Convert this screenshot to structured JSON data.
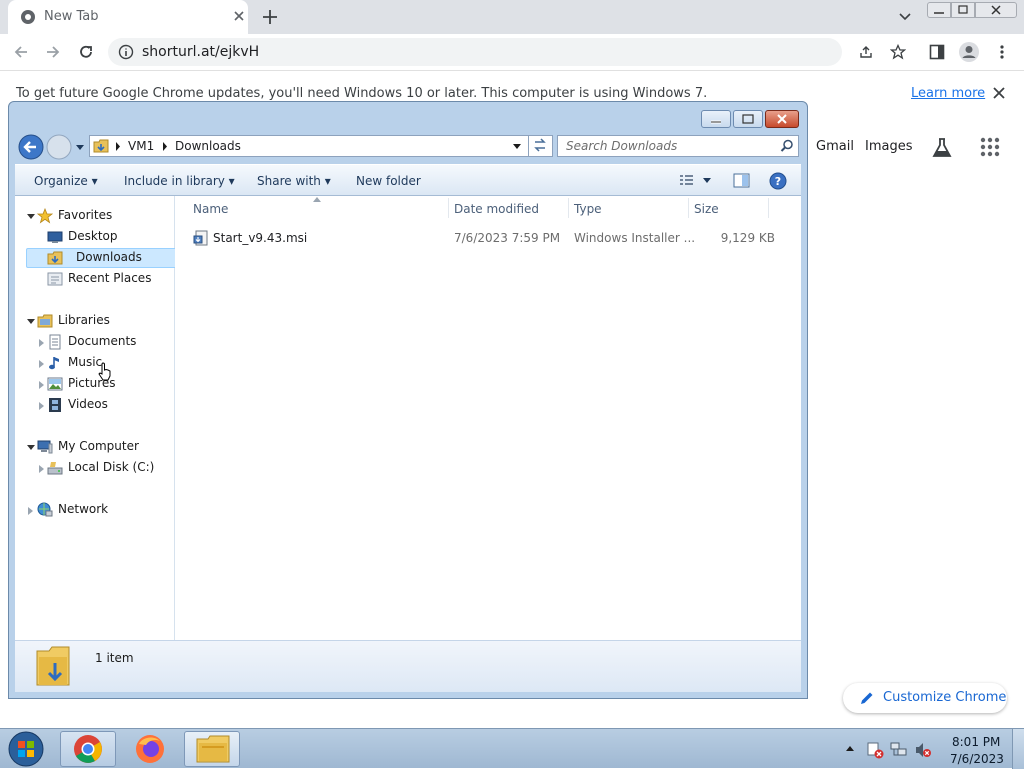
{
  "chrome": {
    "tab_title": "New Tab",
    "url": "shorturl.at/ejkvH",
    "infobar_text": "To get future Google Chrome updates, you'll need Windows 10 or later. This computer is using Windows 7.",
    "learn_more": "Learn more",
    "gmail": "Gmail",
    "images": "Images",
    "customize": "Customize Chrome"
  },
  "explorer": {
    "breadcrumb": [
      "VM1",
      "Downloads"
    ],
    "search_placeholder": "Search Downloads",
    "commands": {
      "organize": "Organize",
      "include": "Include in library",
      "share": "Share with",
      "new_folder": "New folder"
    },
    "nav": {
      "favorites": "Favorites",
      "desktop": "Desktop",
      "downloads": "Downloads",
      "recent": "Recent Places",
      "libraries": "Libraries",
      "documents": "Documents",
      "music": "Music",
      "pictures": "Pictures",
      "videos": "Videos",
      "computer": "My Computer",
      "local_disk": "Local Disk (C:)",
      "network": "Network"
    },
    "columns": {
      "name": "Name",
      "date": "Date modified",
      "type": "Type",
      "size": "Size"
    },
    "files": [
      {
        "name": "Start_v9.43.msi",
        "date": "7/6/2023 7:59 PM",
        "type": "Windows Installer ...",
        "size": "9,129 KB"
      }
    ],
    "status": "1 item"
  },
  "taskbar": {
    "time": "8:01 PM",
    "date": "7/6/2023"
  }
}
